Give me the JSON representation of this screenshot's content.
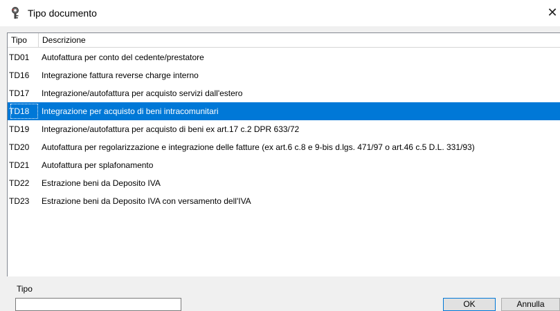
{
  "window": {
    "title": "Tipo documento",
    "icon": "key-lock-icon",
    "close_glyph": "✕"
  },
  "list": {
    "columns": [
      "Tipo",
      "Descrizione"
    ],
    "rows": [
      {
        "code": "TD01",
        "description": "Autofattura per conto del cedente/prestatore",
        "selected": false
      },
      {
        "code": "TD16",
        "description": "Integrazione fattura reverse charge interno",
        "selected": false
      },
      {
        "code": "TD17",
        "description": "Integrazione/autofattura per acquisto servizi dall'estero",
        "selected": false
      },
      {
        "code": "TD18",
        "description": "Integrazione per acquisto di beni intracomunitari",
        "selected": true
      },
      {
        "code": "TD19",
        "description": "Integrazione/autofattura per acquisto di beni ex art.17 c.2 DPR 633/72",
        "selected": false
      },
      {
        "code": "TD20",
        "description": "Autofattura per regolarizzazione e integrazione delle fatture (ex art.6 c.8 e 9-bis d.lgs. 471/97  o  art.46 c.5 D.L. 331/93)",
        "selected": false
      },
      {
        "code": "TD21",
        "description": "Autofattura per splafonamento",
        "selected": false
      },
      {
        "code": "TD22",
        "description": "Estrazione beni da Deposito IVA",
        "selected": false
      },
      {
        "code": "TD23",
        "description": "Estrazione beni da Deposito IVA con versamento dell'IVA",
        "selected": false
      }
    ],
    "selection_color": "#0078d7"
  },
  "form": {
    "tipo_label": "Tipo",
    "tipo_value": "",
    "ok_label": "OK",
    "cancel_label": "Annulla"
  }
}
